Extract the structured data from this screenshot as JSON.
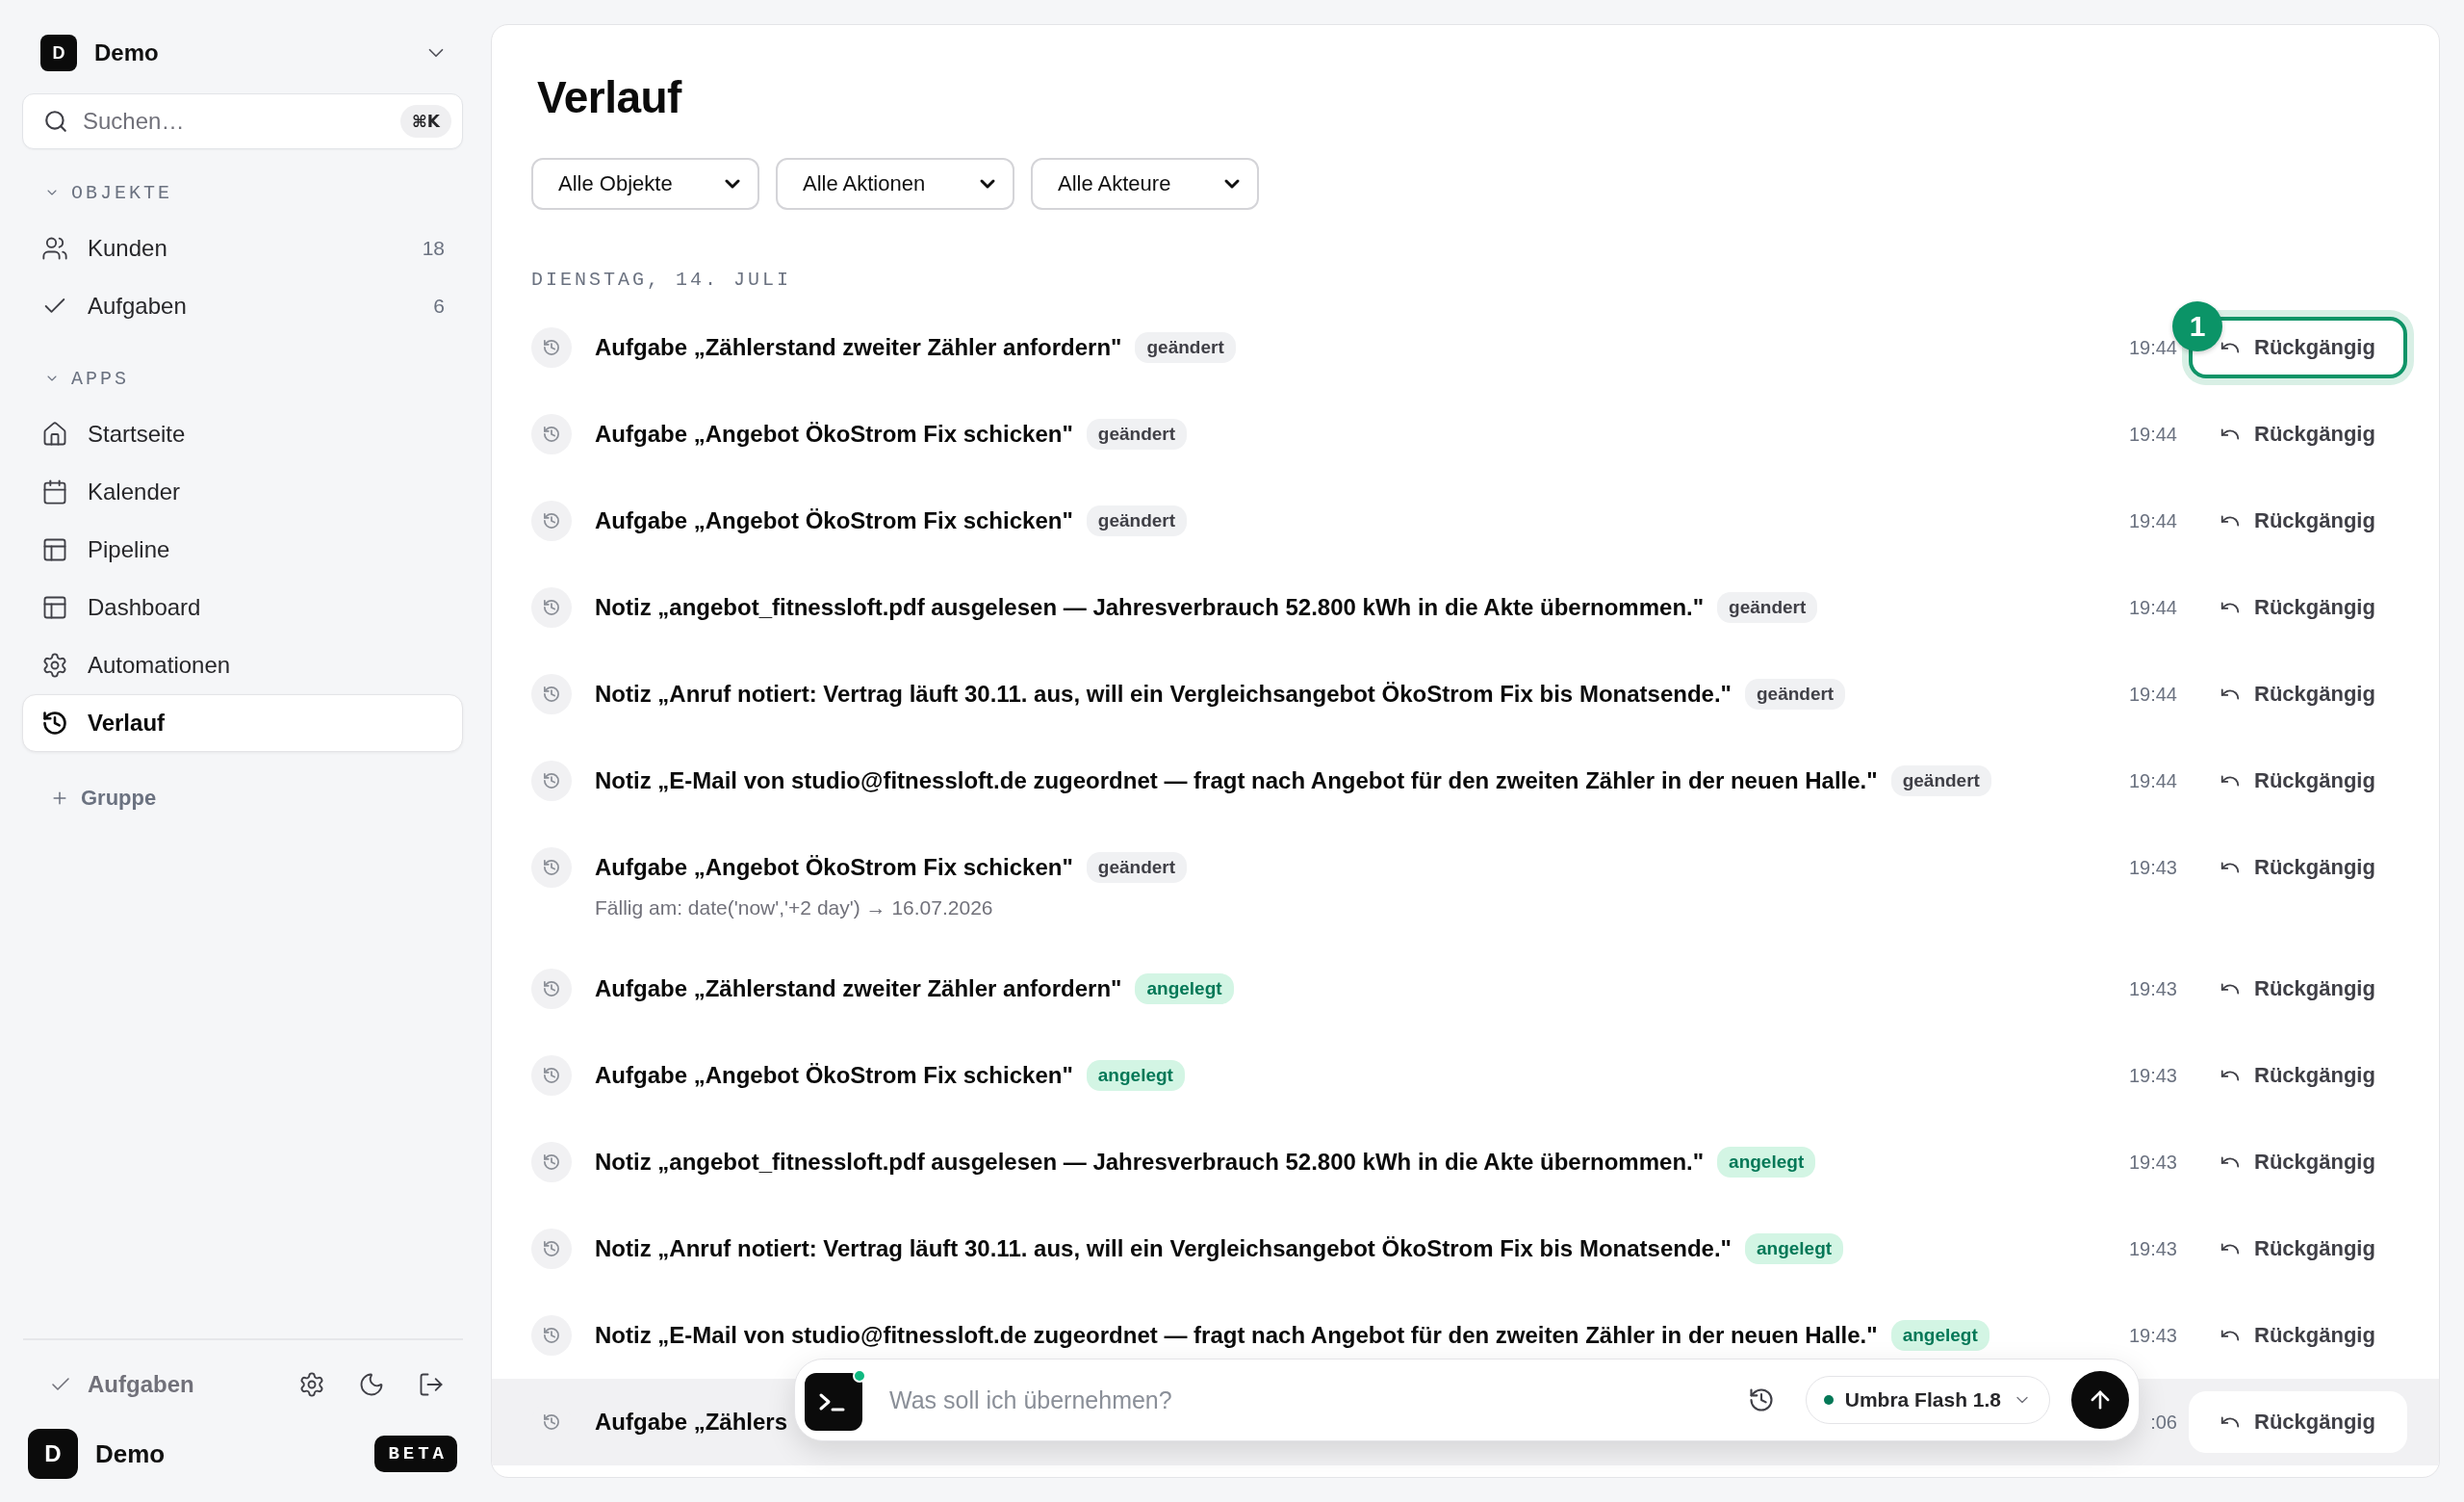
{
  "workspace": {
    "avatar": "D",
    "name": "Demo"
  },
  "search": {
    "placeholder": "Suchen…",
    "shortcut": "⌘K"
  },
  "sidebar": {
    "sections": [
      {
        "title": "OBJEKTE",
        "expanded": true,
        "items": [
          {
            "label": "Kunden",
            "count": "18",
            "selected": false
          },
          {
            "label": "Aufgaben",
            "count": "6",
            "selected": false
          }
        ]
      },
      {
        "title": "APPS",
        "expanded": true,
        "items": [
          {
            "label": "Startseite",
            "selected": false
          },
          {
            "label": "Kalender",
            "selected": false
          },
          {
            "label": "Pipeline",
            "selected": false
          },
          {
            "label": "Dashboard",
            "selected": false
          },
          {
            "label": "Automationen",
            "selected": false
          },
          {
            "label": "Verlauf",
            "selected": true
          }
        ]
      }
    ],
    "add_group": "Gruppe"
  },
  "sidebar_footer": {
    "tasks_link": "Aufgaben",
    "user": {
      "avatar": "D",
      "name": "Demo"
    },
    "badge": "BETA"
  },
  "page": {
    "title": "Verlauf",
    "filters": [
      {
        "value": "Alle Objekte"
      },
      {
        "value": "Alle Aktionen"
      },
      {
        "value": "Alle Akteure"
      }
    ],
    "day": "DIENSTAG, 14. JULI",
    "rows": [
      {
        "title": "Aufgabe „Zählerstand zweiter Zähler anfordern\"",
        "badge": {
          "label": "geändert",
          "kind": "changed"
        },
        "time": "19:44",
        "undo": "Rückgängig",
        "focused": true,
        "callout": "1",
        "hovered": false
      },
      {
        "title": "Aufgabe „Angebot ÖkoStrom Fix schicken\"",
        "badge": {
          "label": "geändert",
          "kind": "changed"
        },
        "time": "19:44",
        "undo": "Rückgängig",
        "focused": false,
        "hovered": false
      },
      {
        "title": "Aufgabe „Angebot ÖkoStrom Fix schicken\"",
        "badge": {
          "label": "geändert",
          "kind": "changed"
        },
        "time": "19:44",
        "undo": "Rückgängig",
        "focused": false,
        "hovered": false
      },
      {
        "title": "Notiz „angebot_fitnessloft.pdf ausgelesen — Jahresverbrauch 52.800 kWh in die Akte übernommen.\"",
        "badge": {
          "label": "geändert",
          "kind": "changed"
        },
        "time": "19:44",
        "undo": "Rückgängig",
        "focused": false,
        "hovered": false
      },
      {
        "title": "Notiz „Anruf notiert: Vertrag läuft 30.11. aus, will ein Vergleichsangebot ÖkoStrom Fix bis Monatsende.\"",
        "badge": {
          "label": "geändert",
          "kind": "changed"
        },
        "time": "19:44",
        "undo": "Rückgängig",
        "focused": false,
        "hovered": false
      },
      {
        "title": "Notiz „E-Mail von studio@fitnessloft.de zugeordnet — fragt nach Angebot für den zweiten Zähler in der neuen Halle.\"",
        "badge": {
          "label": "geändert",
          "kind": "changed"
        },
        "time": "19:44",
        "undo": "Rückgängig",
        "focused": false,
        "hovered": false
      },
      {
        "title": "Aufgabe „Angebot ÖkoStrom Fix schicken\"",
        "badge": {
          "label": "geändert",
          "kind": "changed"
        },
        "detail": "Fällig am: date('now','+2 day') → 16.07.2026",
        "time": "19:43",
        "undo": "Rückgängig",
        "focused": false,
        "hovered": false
      },
      {
        "title": "Aufgabe „Zählerstand zweiter Zähler anfordern\"",
        "badge": {
          "label": "angelegt",
          "kind": "created"
        },
        "time": "19:43",
        "undo": "Rückgängig",
        "focused": false,
        "hovered": false
      },
      {
        "title": "Aufgabe „Angebot ÖkoStrom Fix schicken\"",
        "badge": {
          "label": "angelegt",
          "kind": "created"
        },
        "time": "19:43",
        "undo": "Rückgängig",
        "focused": false,
        "hovered": false
      },
      {
        "title": "Notiz „angebot_fitnessloft.pdf ausgelesen — Jahresverbrauch 52.800 kWh in die Akte übernommen.\"",
        "badge": {
          "label": "angelegt",
          "kind": "created"
        },
        "time": "19:43",
        "undo": "Rückgängig",
        "focused": false,
        "hovered": false
      },
      {
        "title": "Notiz „Anruf notiert: Vertrag läuft 30.11. aus, will ein Vergleichsangebot ÖkoStrom Fix bis Monatsende.\"",
        "badge": {
          "label": "angelegt",
          "kind": "created"
        },
        "time": "19:43",
        "undo": "Rückgängig",
        "focused": false,
        "hovered": false
      },
      {
        "title": "Notiz „E-Mail von studio@fitnessloft.de zugeordnet — fragt nach Angebot für den zweiten Zähler in der neuen Halle.\"",
        "badge": {
          "label": "angelegt",
          "kind": "created"
        },
        "time": "19:43",
        "undo": "Rückgängig",
        "focused": false,
        "hovered": false
      },
      {
        "title": "Aufgabe „Zählers",
        "time": ":06",
        "undo": "Rückgängig",
        "focused": false,
        "hovered": true
      }
    ]
  },
  "assistant": {
    "placeholder": "Was soll ich übernehmen?",
    "model": "Umbra Flash 1.8"
  }
}
